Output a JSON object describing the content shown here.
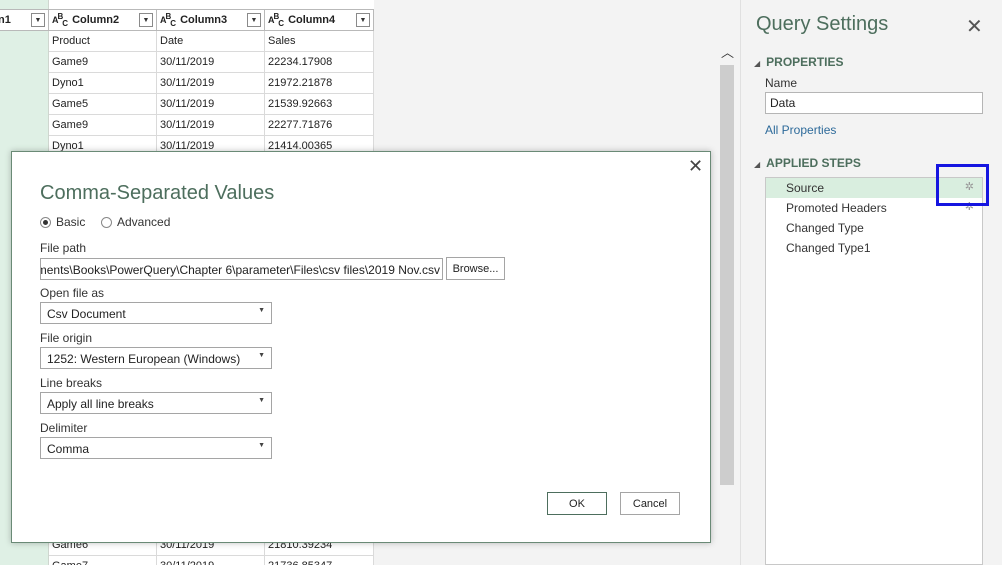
{
  "grid": {
    "partial_header": "n1",
    "columns": [
      {
        "type_icon": "ABC",
        "label": "Column2"
      },
      {
        "type_icon": "ABC",
        "label": "Column3"
      },
      {
        "type_icon": "ABC",
        "label": "Column4"
      }
    ],
    "rows": [
      [
        "Product",
        "Date",
        "Sales"
      ],
      [
        "Game9",
        "30/11/2019",
        "22234.17908"
      ],
      [
        "Dyno1",
        "30/11/2019",
        "21972.21878"
      ],
      [
        "Game5",
        "30/11/2019",
        "21539.92663"
      ],
      [
        "Game9",
        "30/11/2019",
        "22277.71876"
      ],
      [
        "Dyno1",
        "30/11/2019",
        "21414.00365"
      ]
    ],
    "bottom_rows": [
      [
        "Game6",
        "30/11/2019",
        "21810.39234"
      ],
      [
        "Game7",
        "30/11/2019",
        "21736.85347"
      ]
    ],
    "first_col_color": "#dff0e5"
  },
  "dialog": {
    "title": "Comma-Separated Values",
    "radio_basic": "Basic",
    "radio_advanced": "Advanced",
    "selected_mode": "Basic",
    "file_path_label": "File path",
    "file_path_value": "ments\\Books\\PowerQuery\\Chapter 6\\parameter\\Files\\csv files\\2019 Nov.csv",
    "browse_label": "Browse...",
    "open_as_label": "Open file as",
    "open_as_value": "Csv Document",
    "origin_label": "File origin",
    "origin_value": "1252: Western European (Windows)",
    "line_breaks_label": "Line breaks",
    "line_breaks_value": "Apply all line breaks",
    "delimiter_label": "Delimiter",
    "delimiter_value": "Comma",
    "ok_label": "OK",
    "cancel_label": "Cancel"
  },
  "query_settings": {
    "title": "Query Settings",
    "properties_header": "PROPERTIES",
    "name_label": "Name",
    "name_value": "Data",
    "all_properties": "All Properties",
    "applied_steps_header": "APPLIED STEPS",
    "steps": [
      {
        "label": "Source",
        "active": true,
        "gear": true
      },
      {
        "label": "Promoted Headers",
        "active": false,
        "gear": true
      },
      {
        "label": "Changed Type",
        "active": false,
        "gear": false
      },
      {
        "label": "Changed Type1",
        "active": false,
        "gear": false
      }
    ],
    "accent_color": "#4d6e5d",
    "highlight_color": "#1515e0"
  }
}
